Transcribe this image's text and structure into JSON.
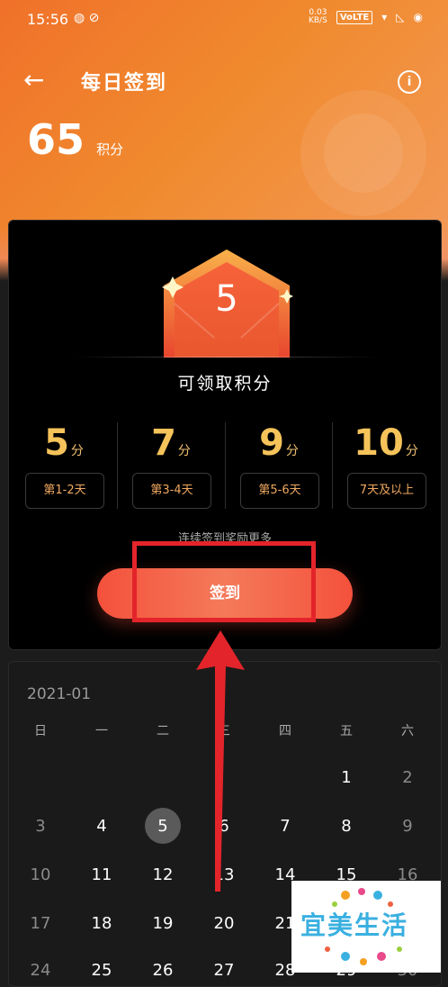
{
  "status": {
    "time": "15:56",
    "net_speed_top": "0.03",
    "net_speed_bottom": "KB/S",
    "volte": "VoLTE"
  },
  "nav": {
    "title": "每日签到"
  },
  "points": {
    "value": "65",
    "unit": "积分"
  },
  "card": {
    "badge_value": "5",
    "claim_label": "可领取积分",
    "tiers": [
      {
        "value": "5",
        "unit": "分",
        "label": "第1-2天"
      },
      {
        "value": "7",
        "unit": "分",
        "label": "第3-4天"
      },
      {
        "value": "9",
        "unit": "分",
        "label": "第5-6天"
      },
      {
        "value": "10",
        "unit": "分",
        "label": "7天及以上"
      }
    ],
    "hint": "连续签到奖励更多",
    "signin_label": "签到"
  },
  "calendar": {
    "month": "2021-01",
    "weekdays": [
      "日",
      "一",
      "二",
      "三",
      "四",
      "五",
      "六"
    ],
    "rows": [
      [
        "",
        "",
        "",
        "",
        "",
        "1",
        "2"
      ],
      [
        "3",
        "4",
        "5",
        "6",
        "7",
        "8",
        "9"
      ],
      [
        "10",
        "11",
        "12",
        "13",
        "14",
        "15",
        "16"
      ],
      [
        "17",
        "18",
        "19",
        "20",
        "21",
        "22",
        "23"
      ],
      [
        "24",
        "25",
        "26",
        "27",
        "28",
        "29",
        "30"
      ]
    ],
    "today": "5"
  },
  "watermark": {
    "text": "宜美生活"
  },
  "colors": {
    "accent": "#f0712a",
    "signin": "#f4513c",
    "highlight": "#e3242b",
    "tier_gold": "#f5c35a"
  }
}
